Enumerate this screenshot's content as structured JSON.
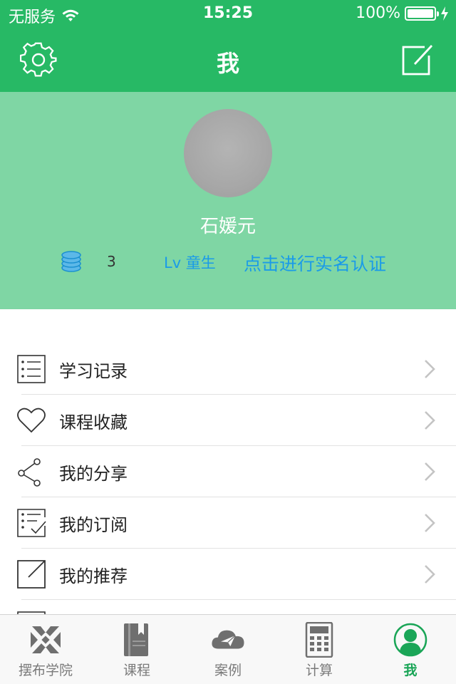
{
  "status_bar": {
    "carrier": "无服务",
    "time": "15:25",
    "battery": "100%",
    "battery_level": 1.0
  },
  "nav": {
    "title": "我"
  },
  "profile": {
    "username": "石媛元",
    "coins": "3",
    "level": "Lv 童生",
    "verify_link": "点击进行实名认证"
  },
  "menu": {
    "items": [
      {
        "label": "学习记录",
        "icon": "list-icon"
      },
      {
        "label": "课程收藏",
        "icon": "heart-icon"
      },
      {
        "label": "我的分享",
        "icon": "share-icon"
      },
      {
        "label": "我的订阅",
        "icon": "subscription-icon"
      },
      {
        "label": "我的推荐",
        "icon": "recommend-icon"
      }
    ]
  },
  "tabs": [
    {
      "label": "摆布学院",
      "icon": "academy-icon"
    },
    {
      "label": "课程",
      "icon": "book-icon"
    },
    {
      "label": "案例",
      "icon": "cloud-icon"
    },
    {
      "label": "计算",
      "icon": "calculator-icon"
    },
    {
      "label": "我",
      "icon": "profile-icon",
      "active": true
    }
  ],
  "colors": {
    "header": "#27b965",
    "profile_bg": "#7fd6a4",
    "link": "#1a9be8",
    "active_tab": "#1aa557"
  }
}
